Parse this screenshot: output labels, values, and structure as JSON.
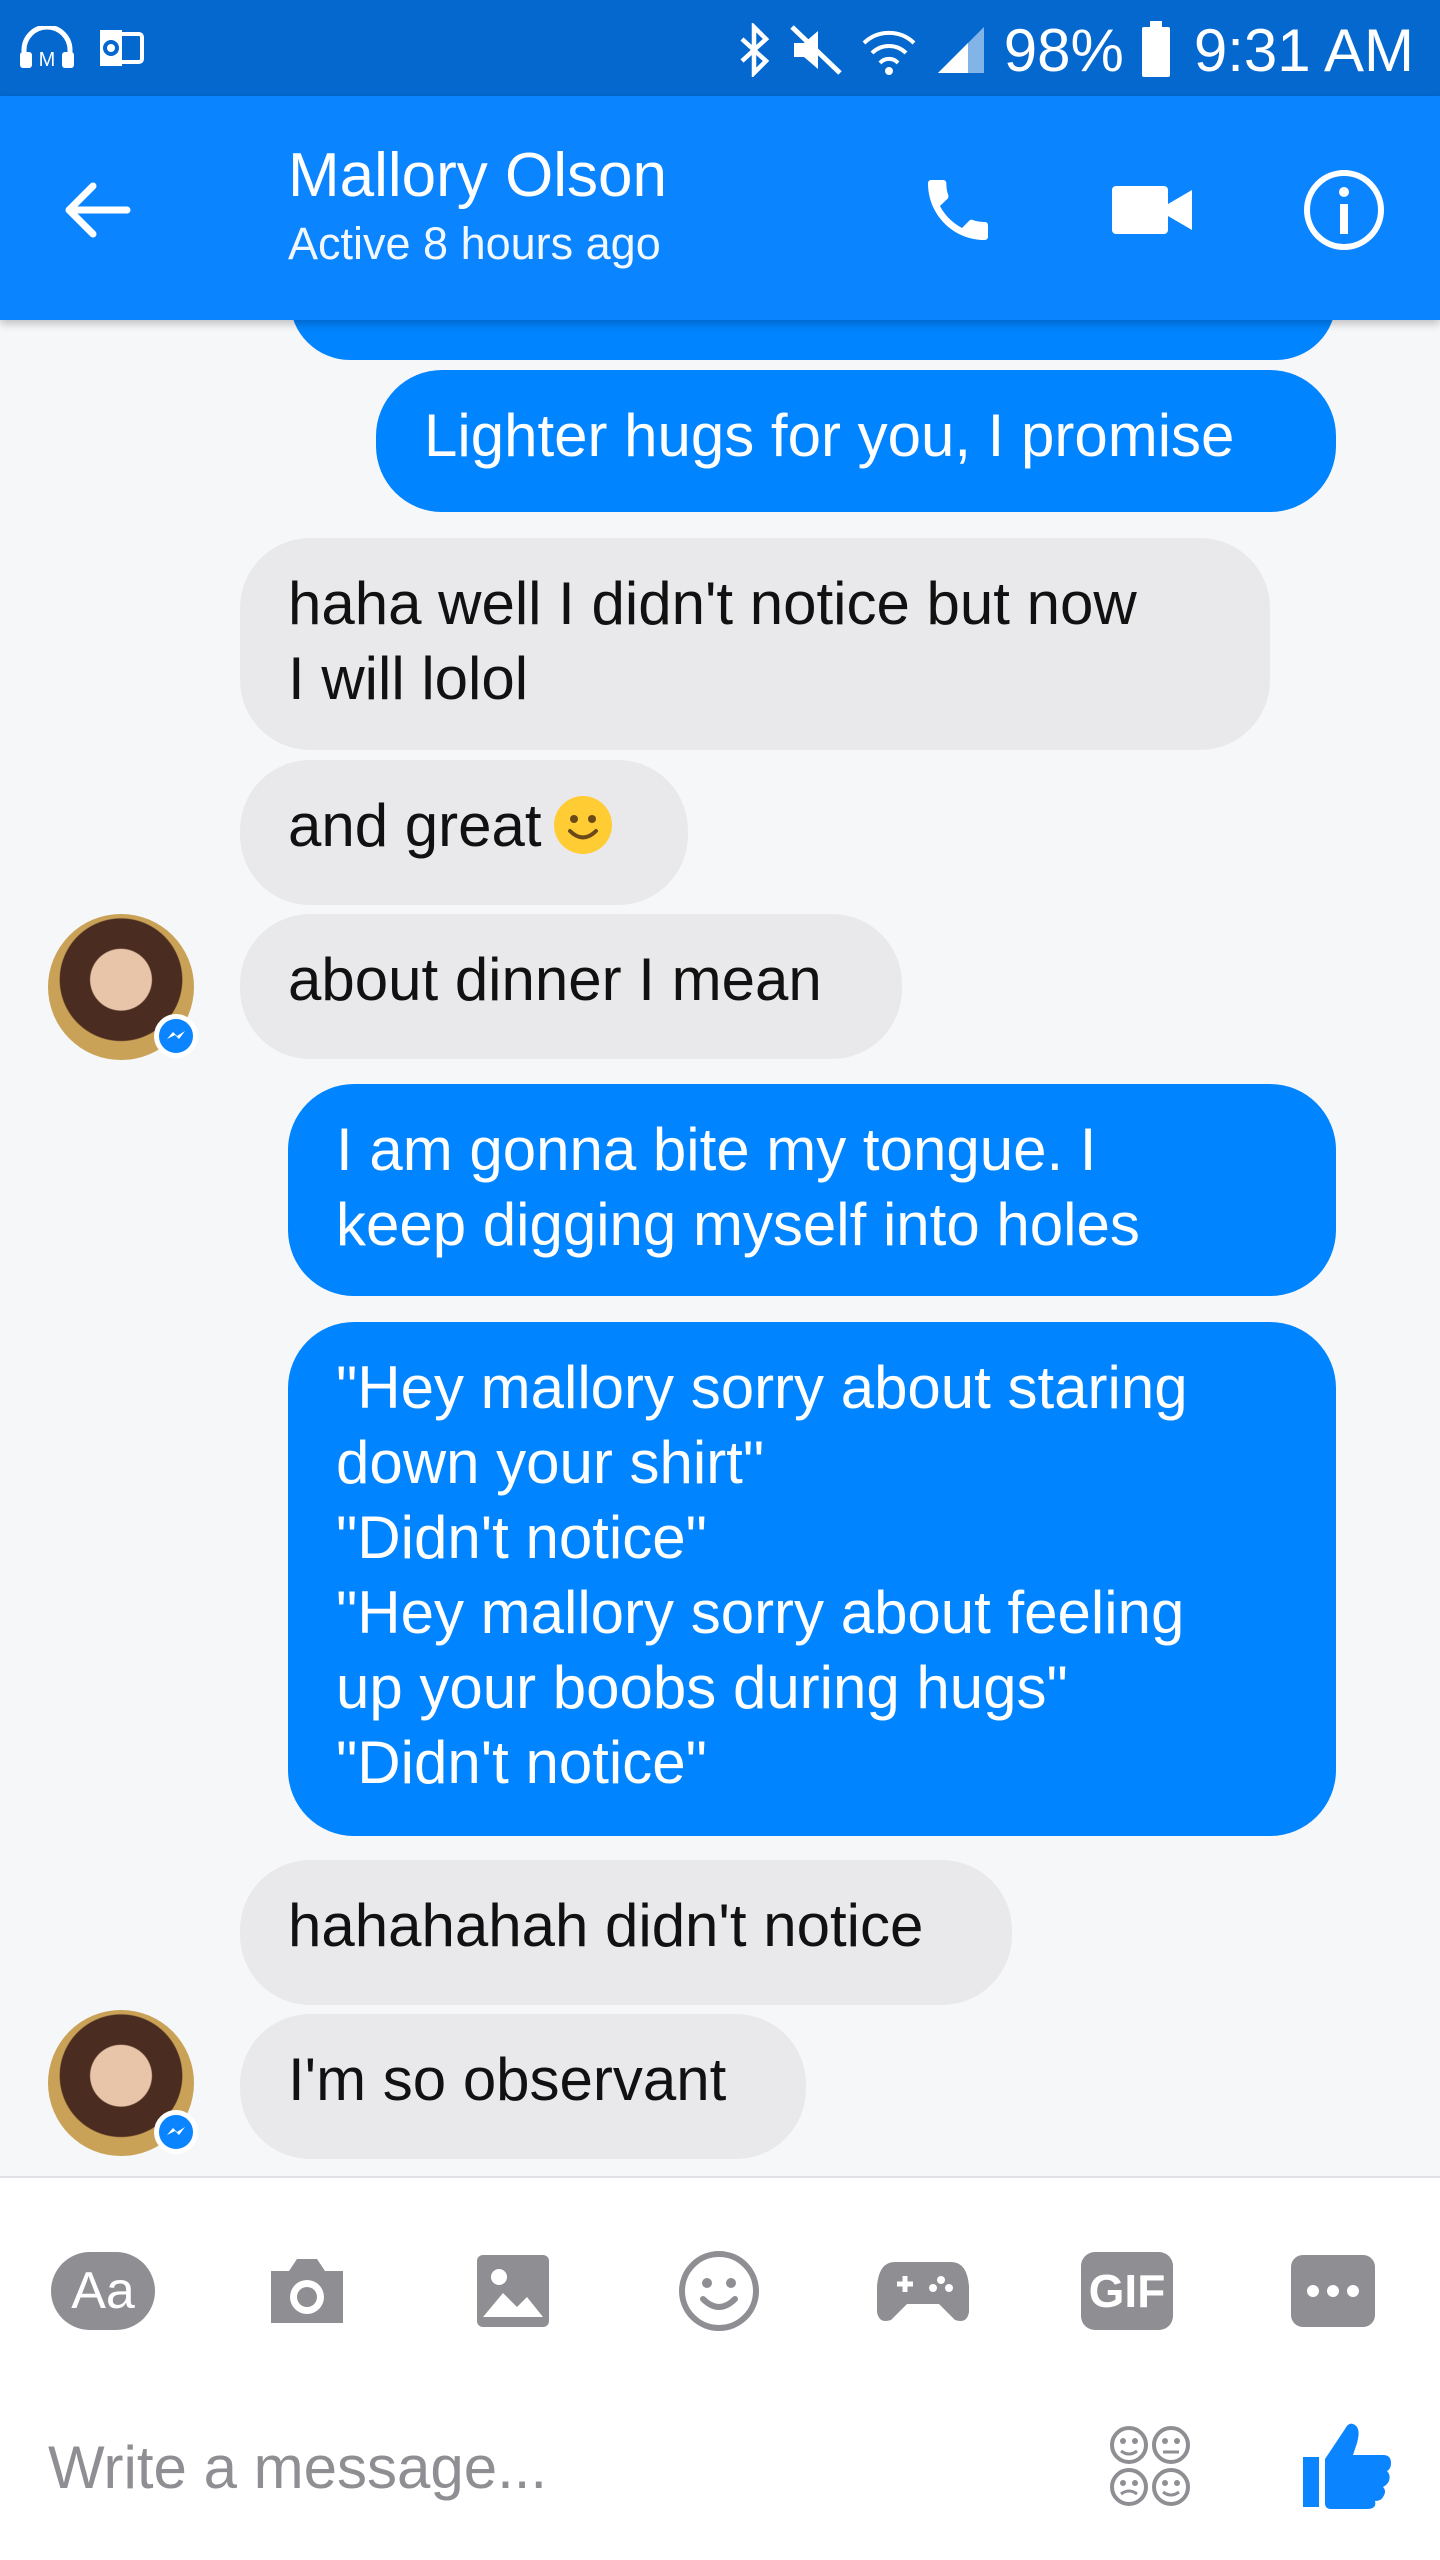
{
  "status_bar": {
    "battery": "98%",
    "time": "9:31 AM",
    "icons": [
      "headphones-icon",
      "outlook-icon",
      "bluetooth-icon",
      "mute-icon",
      "wifi-icon",
      "signal-icon",
      "battery-icon"
    ]
  },
  "header": {
    "name": "Mallory Olson",
    "status": "Active 8 hours ago",
    "accent_color": "#0a84ff"
  },
  "messages": [
    {
      "from": "me",
      "text": ""
    },
    {
      "from": "me",
      "text": "Lighter hugs for you, I promise"
    },
    {
      "from": "them",
      "text": "haha well I didn't notice but now\nI will lolol"
    },
    {
      "from": "them",
      "text": "and great"
    },
    {
      "from": "them",
      "text": "about dinner I mean"
    },
    {
      "from": "me",
      "text": "I am gonna bite my tongue. I\nkeep digging myself into holes"
    },
    {
      "from": "me",
      "text": "\"Hey mallory sorry about staring\ndown your shirt\"\n\"Didn't notice\"\n\"Hey mallory sorry about feeling\nup your boobs during hugs\"\n\"Didn't notice\""
    },
    {
      "from": "them",
      "text": "hahahahah didn't notice"
    },
    {
      "from": "them",
      "text": "I'm so observant"
    }
  ],
  "composer": {
    "aa_label": "Aa",
    "gif_label": "GIF",
    "placeholder": "Write a message...",
    "tools": [
      "text-size-button",
      "camera-icon",
      "gallery-icon",
      "emoji-icon",
      "games-icon",
      "gif-button",
      "more-button"
    ]
  }
}
